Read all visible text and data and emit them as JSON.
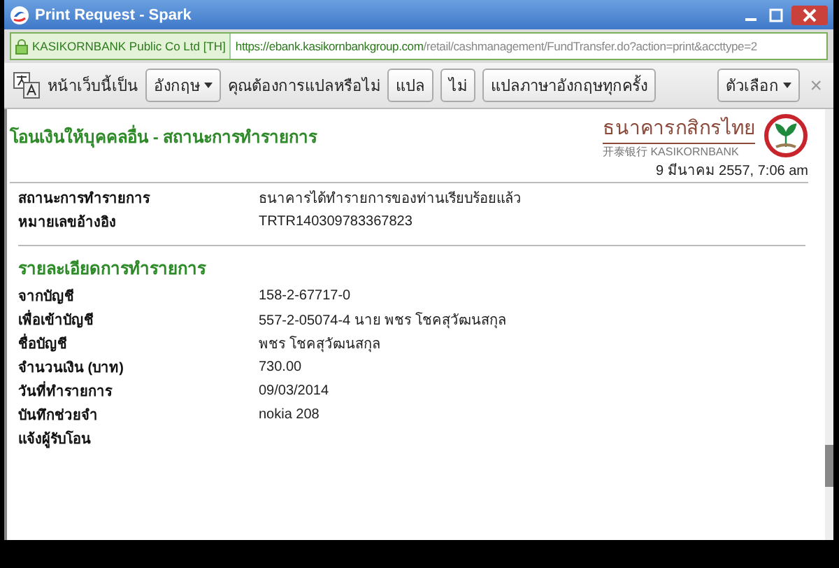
{
  "window": {
    "title": "Print Request - Spark"
  },
  "address_bar": {
    "site_identity": "KASIKORNBANK Public Co Ltd [TH]",
    "url_host": "https://ebank.kasikornbankgroup.com",
    "url_path": "/retail/cashmanagement/FundTransfer.do?action=print&accttype=2"
  },
  "translate_bar": {
    "prompt": "หน้าเว็บนี้เป็น",
    "language": "อังกฤษ",
    "question": "คุณต้องการแปลหรือไม่",
    "buttons": [
      "แปล",
      "ไม่",
      "แปลภาษาอังกฤษทุกครั้ง"
    ],
    "options": "ตัวเลือก",
    "close": "×"
  },
  "page": {
    "title": "โอนเงินให้บุคคลอื่น - สถานะการทำรายการ",
    "logo": {
      "thai": "ธนาคารกสิกรไทย",
      "english": "开泰银行 KASIKORNBANK"
    },
    "timestamp": "9 มีนาคม 2557, 7:06 am",
    "status_rows": [
      {
        "label": "สถานะการทำรายการ",
        "value": "ธนาคารได้ทำรายการของท่านเรียบร้อยแล้ว"
      },
      {
        "label": "หมายเลขอ้างอิง",
        "value": "TRTR140309783367823"
      }
    ],
    "details_title": "รายละเอียดการทำรายการ",
    "detail_rows": [
      {
        "label": "จากบัญชี",
        "value": "158-2-67717-0"
      },
      {
        "label": "เพื่อเข้าบัญชี",
        "value": "557-2-05074-4 นาย พชร โชคสุวัฒนสกุล"
      },
      {
        "label": "ชื่อบัญชี",
        "value": "พชร โชคสุวัฒนสกุล"
      },
      {
        "label": "จำนวนเงิน (บาท)",
        "value": "730.00"
      },
      {
        "label": "วันที่ทำรายการ",
        "value": "09/03/2014"
      },
      {
        "label": "บันทึกช่วยจำ",
        "value": "nokia 208"
      },
      {
        "label": "แจ้งผู้รับโอน",
        "value": ""
      }
    ]
  }
}
